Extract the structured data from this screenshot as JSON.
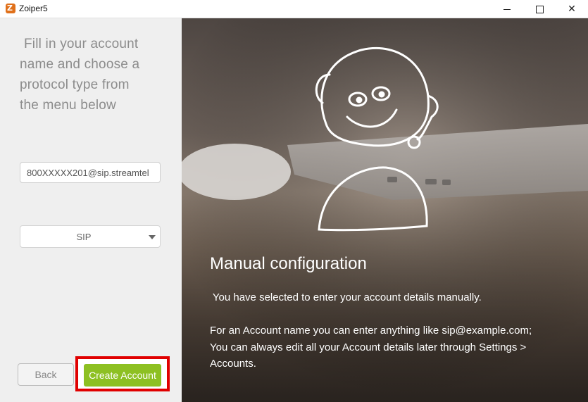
{
  "window": {
    "title": "Zoiper5",
    "app_icon_glyph": "Z",
    "minimize_icon": "minimize-icon",
    "maximize_icon": "maximize-icon",
    "close_glyph": "✕"
  },
  "sidebar": {
    "instructions": [
      "Fill in your account",
      "name and choose a",
      "protocol type from",
      "the menu below"
    ],
    "account_input_value": "800XXXXX201@sip.streamtel",
    "protocol_selected": "SIP",
    "back_label": "Back",
    "create_label": "Create Account"
  },
  "main": {
    "heading": "Manual configuration",
    "paragraph1": " You have selected to enter your account details manually.",
    "paragraph2": "For an Account name you can enter anything like sip@example.com; You can always edit all your Account details later through Settings > Accounts."
  },
  "colors": {
    "accent_green": "#8dc022",
    "highlight_red": "#e00000",
    "sidebar_bg": "#efefef"
  }
}
